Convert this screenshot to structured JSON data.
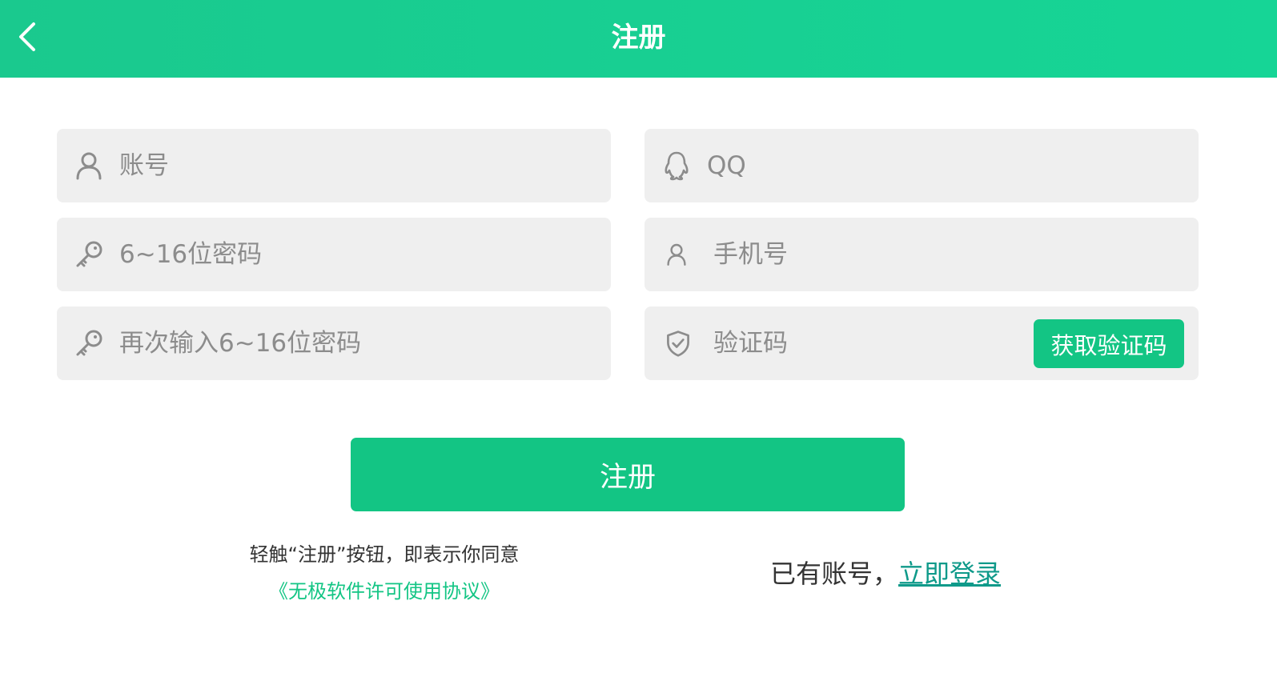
{
  "header": {
    "title": "注册",
    "back_icon": "chevron-left-icon"
  },
  "form": {
    "account": {
      "placeholder": "账号",
      "value": "",
      "icon": "user-icon"
    },
    "qq": {
      "placeholder": "QQ",
      "value": "",
      "icon": "qq-penguin-icon"
    },
    "password": {
      "placeholder": "6~16位密码",
      "value": "",
      "icon": "key-icon"
    },
    "phone": {
      "placeholder": "手机号",
      "value": "",
      "icon": "user-icon"
    },
    "password_confirm": {
      "placeholder": "再次输入6~16位密码",
      "value": "",
      "icon": "key-icon"
    },
    "verify_code": {
      "placeholder": "验证码",
      "value": "",
      "icon": "shield-check-icon"
    },
    "get_code_label": "获取验证码"
  },
  "actions": {
    "register_label": "注册"
  },
  "agreement": {
    "text": "轻触“注册”按钮，即表示你同意",
    "link": "《无极软件许可使用协议》"
  },
  "login": {
    "prompt": "已有账号，",
    "link": "立即登录"
  },
  "colors": {
    "header_start": "#1ac98e",
    "header_end": "#16d596",
    "accent": "#13c584",
    "field_bg": "#efefef",
    "login_link": "#0f9a8a",
    "placeholder": "#8c8c8c"
  }
}
